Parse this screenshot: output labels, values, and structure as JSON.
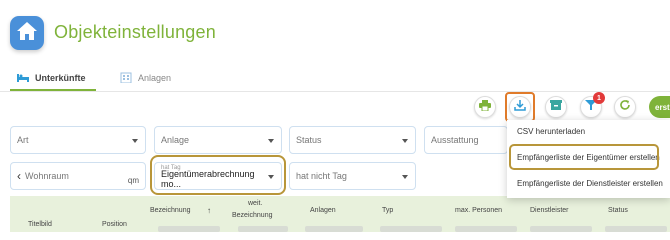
{
  "header": {
    "title": "Objekteinstellungen",
    "home_icon": "house-icon"
  },
  "tabs": [
    {
      "label": "Unterkünfte",
      "icon": "bed-icon",
      "active": true
    },
    {
      "label": "Anlagen",
      "icon": "building-icon",
      "active": false
    }
  ],
  "toolbar": {
    "buttons": [
      {
        "name": "print",
        "icon": "printer-icon",
        "color": "#7fb33a"
      },
      {
        "name": "download",
        "icon": "download-icon",
        "color": "#2e9bd6"
      },
      {
        "name": "archive",
        "icon": "archive-icon",
        "color": "#3aa6a0"
      },
      {
        "name": "filter",
        "icon": "filter-icon",
        "color": "#2e9bd6"
      },
      {
        "name": "refresh",
        "icon": "refresh-icon",
        "color": "#7fb33a"
      }
    ],
    "filter_badge": "1",
    "create_label": "erst"
  },
  "filters": {
    "art": "Art",
    "anlage": "Anlage",
    "status": "Status",
    "ausstattung": "Ausstattung",
    "wohnraum": "Wohnraum",
    "wohnraum_unit": "qm",
    "hat_tag_label": "hat Tag",
    "hat_tag_value": "Eigentümerabrechnung mo...",
    "hat_nicht_tag": "hat nicht Tag"
  },
  "download_menu": {
    "items": [
      "CSV herunterladen",
      "Empfängerliste der Eigentümer erstellen",
      "Empfängerliste der Dienstleister erstellen"
    ]
  },
  "table": {
    "columns": {
      "titelbild": "Titelbild",
      "position": "Position",
      "bezeichnung": "Bezeichnung",
      "sort_arrow": "↑",
      "weit_bezeichnung_1": "weit.",
      "weit_bezeichnung_2": "Bezeichnung",
      "anlagen": "Anlagen",
      "typ": "Typ",
      "max_personen": "max. Personen",
      "dienstleister": "Dienstleister",
      "status": "Status"
    }
  },
  "colors": {
    "brand_green": "#7fb33a",
    "accent_blue": "#2e9bd6",
    "highlight_orange": "#e07b2a",
    "highlight_gold": "#b8963a"
  }
}
